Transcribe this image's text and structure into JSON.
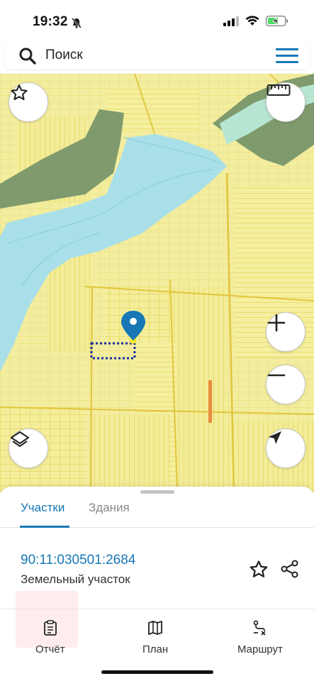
{
  "status_bar": {
    "time": "19:32",
    "icons": [
      "bell-slash-icon",
      "signal-icon",
      "wifi-icon",
      "battery-charging-icon"
    ]
  },
  "search": {
    "placeholder": "Поиск"
  },
  "map": {
    "controls": [
      "favorite-star",
      "ruler",
      "zoom-in",
      "zoom-out",
      "layers",
      "my-location"
    ],
    "colors": {
      "parcel_fill": "#f4ed9a",
      "parcel_line": "#e4cf4a",
      "water": "#a9dfe9",
      "forest": "#7d9a6b",
      "selection": "#1a2fa8",
      "marker": "#1778b5"
    }
  },
  "sheet": {
    "tabs": [
      {
        "label": "Участки",
        "active": true
      },
      {
        "label": "Здания",
        "active": false
      }
    ],
    "cadastral_number": "90:11:030501:2684",
    "parcel_type": "Земельный участок"
  },
  "bottom_nav": {
    "items": [
      {
        "label": "Отчёт",
        "icon": "clipboard-icon"
      },
      {
        "label": "План",
        "icon": "map-icon"
      },
      {
        "label": "Маршрут",
        "icon": "route-icon"
      }
    ]
  },
  "accent_color": "#1778b5"
}
